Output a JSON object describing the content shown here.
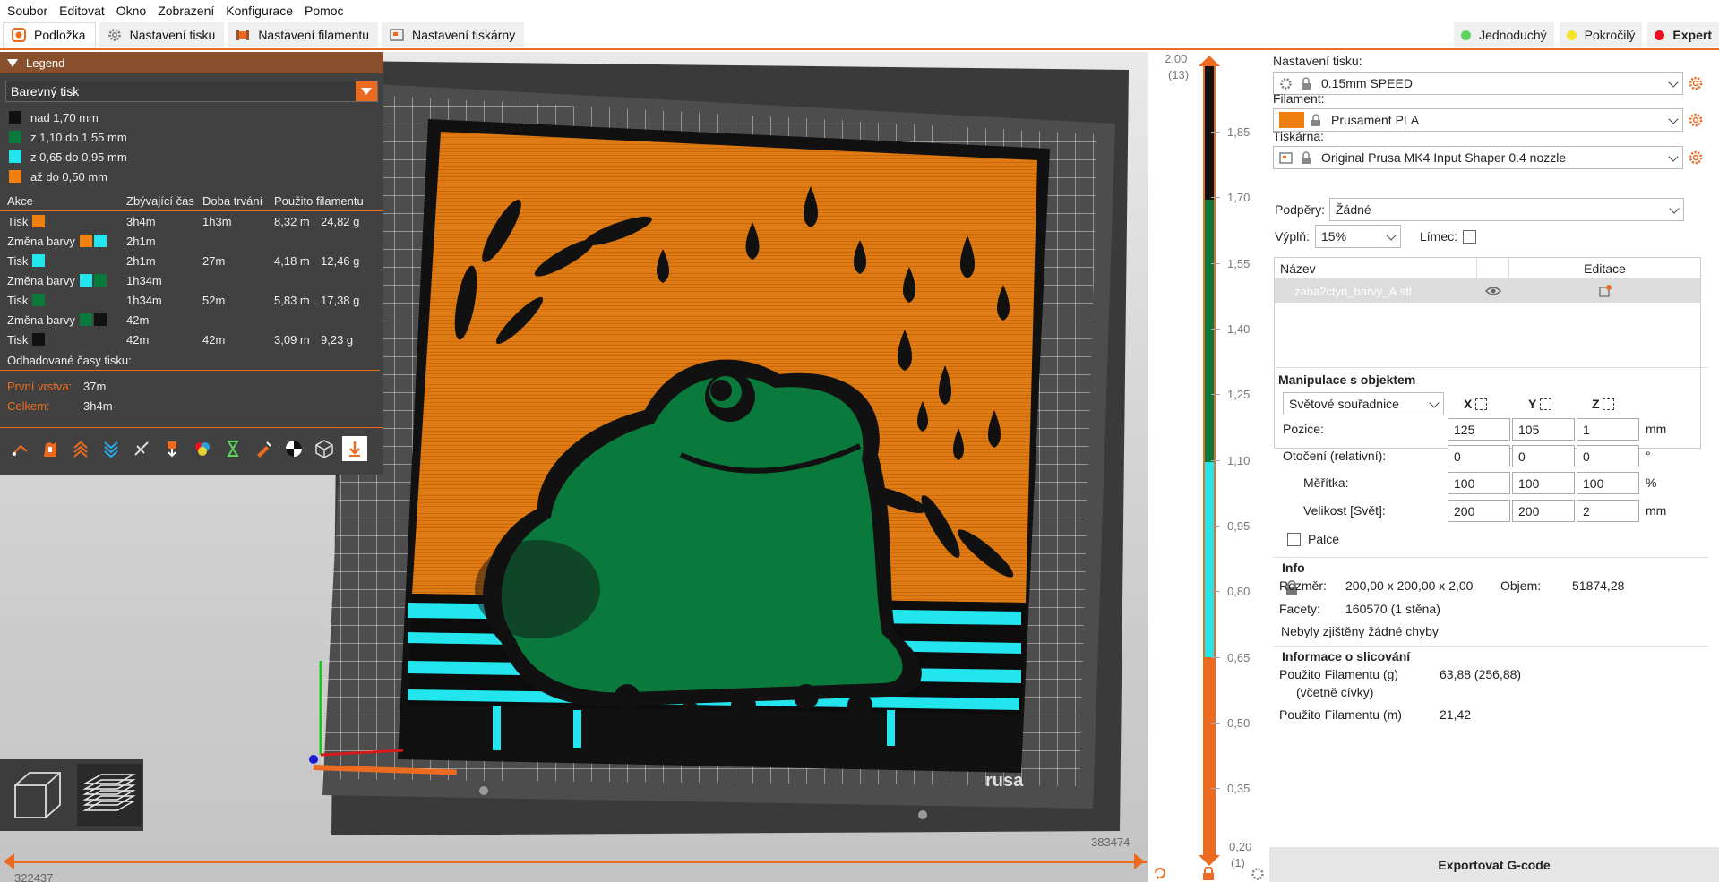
{
  "menu": [
    "Soubor",
    "Editovat",
    "Okno",
    "Zobrazení",
    "Konfigurace",
    "Pomoc"
  ],
  "tabs": [
    {
      "label": "Podložka",
      "icon": "plate-icon",
      "active": true
    },
    {
      "label": "Nastavení tisku",
      "icon": "gear-icon",
      "active": false
    },
    {
      "label": "Nastavení filamentu",
      "icon": "filament-spool-icon",
      "active": false
    },
    {
      "label": "Nastavení tiskárny",
      "icon": "printer-icon",
      "active": false
    }
  ],
  "modes": [
    {
      "label": "Jednoduchý",
      "color": "#5fd35f"
    },
    {
      "label": "Pokročilý",
      "color": "#f5e32a"
    },
    {
      "label": "Expert",
      "color": "#e81022"
    }
  ],
  "legend": {
    "title": "Legend",
    "view_type": "Barevný tisk",
    "ranges": [
      {
        "label": "nad 1,70 mm",
        "color": "#111111"
      },
      {
        "label": "z 1,10 do 1,55 mm",
        "color": "#0a7a3c"
      },
      {
        "label": "z 0,65 do 0,95 mm",
        "color": "#22e5ee"
      },
      {
        "label": "až do 0,50 mm",
        "color": "#f07f10"
      }
    ],
    "columns": [
      "Akce",
      "Zbývající čas",
      "Doba trvání",
      "Použito filamentu"
    ],
    "rows": [
      {
        "action": "Tisk",
        "colors": [
          "#f07f10"
        ],
        "remaining": "3h4m",
        "duration": "1h3m",
        "length": "8,32 m",
        "weight": "24,82 g"
      },
      {
        "action": "Změna barvy",
        "colors": [
          "#f07f10",
          "#22e5ee"
        ],
        "remaining": "2h1m",
        "duration": "",
        "length": "",
        "weight": ""
      },
      {
        "action": "Tisk",
        "colors": [
          "#22e5ee"
        ],
        "remaining": "2h1m",
        "duration": "27m",
        "length": "4,18 m",
        "weight": "12,46 g"
      },
      {
        "action": "Změna barvy",
        "colors": [
          "#22e5ee",
          "#0a7a3c"
        ],
        "remaining": "1h34m",
        "duration": "",
        "length": "",
        "weight": ""
      },
      {
        "action": "Tisk",
        "colors": [
          "#0a7a3c"
        ],
        "remaining": "1h34m",
        "duration": "52m",
        "length": "5,83 m",
        "weight": "17,38 g"
      },
      {
        "action": "Změna barvy",
        "colors": [
          "#0a7a3c",
          "#111111"
        ],
        "remaining": "42m",
        "duration": "",
        "length": "",
        "weight": ""
      },
      {
        "action": "Tisk",
        "colors": [
          "#111111"
        ],
        "remaining": "42m",
        "duration": "42m",
        "length": "3,09 m",
        "weight": "9,23 g"
      }
    ],
    "estimated_title": "Odhadované časy tisku:",
    "first_layer_label": "První vrstva:",
    "first_layer_value": "37m",
    "total_label": "Celkem:",
    "total_value": "3h4m"
  },
  "hslider": {
    "left_value": "322437",
    "right_value": "383474"
  },
  "vslider": {
    "top_value": "2,00",
    "top_layer": "(13)",
    "bottom_value": "0,20",
    "bottom_layer": "(1)",
    "ticks": [
      "1,85",
      "1,70",
      "1,55",
      "1,40",
      "1,25",
      "1,10",
      "0,95",
      "0,80",
      "0,65",
      "0,50",
      "0,35"
    ]
  },
  "panel": {
    "print_settings_label": "Nastavení tisku:",
    "print_settings_value": "0.15mm SPEED",
    "filament_label": "Filament:",
    "filament_value": "Prusament PLA",
    "filament_color": "#f07f10",
    "printer_label": "Tiskárna:",
    "printer_value": "Original Prusa MK4 Input Shaper 0.4 nozzle",
    "supports_label": "Podpěry:",
    "supports_value": "Žádné",
    "infill_label": "Výplň:",
    "infill_value": "15%",
    "brim_label": "Límec:",
    "list_name_col": "Název",
    "list_edit_col": "Editace",
    "object_name": "zaba2ctyri_barvy_A.stl"
  },
  "manip": {
    "title": "Manipulace s objektem",
    "coord_system": "Světové souřadnice",
    "axes": [
      "X",
      "Y",
      "Z"
    ],
    "rows": [
      {
        "label": "Pozice:",
        "values": [
          "125",
          "105",
          "1"
        ],
        "unit": "mm"
      },
      {
        "label": "Otočení (relativní):",
        "values": [
          "0",
          "0",
          "0"
        ],
        "unit": "°"
      },
      {
        "label": "Měřítka:",
        "values": [
          "100",
          "100",
          "100"
        ],
        "unit": "%"
      },
      {
        "label": "Velikost [Svět]:",
        "values": [
          "200",
          "200",
          "2"
        ],
        "unit": "mm"
      }
    ],
    "inches_label": "Palce"
  },
  "info": {
    "title": "Info",
    "size_label": "Rozměr:",
    "size_value": "200,00 x 200,00 x 2,00",
    "volume_label": "Objem:",
    "volume_value": "51874,28",
    "facets_label": "Facety:",
    "facets_value": "160570 (1 stěna)",
    "errors": "Nebyly zjištěny žádné chyby"
  },
  "slice": {
    "title": "Informace o slicování",
    "used_g_label": "Použito Filamentu (g)",
    "used_g_sub": "(včetně cívky)",
    "used_g_value": "63,88 (256,88)",
    "used_m_label": "Použito Filamentu (m)",
    "used_m_value": "21,42"
  },
  "export_label": "Exportovat G-code",
  "bed_logo_text": "rusa"
}
